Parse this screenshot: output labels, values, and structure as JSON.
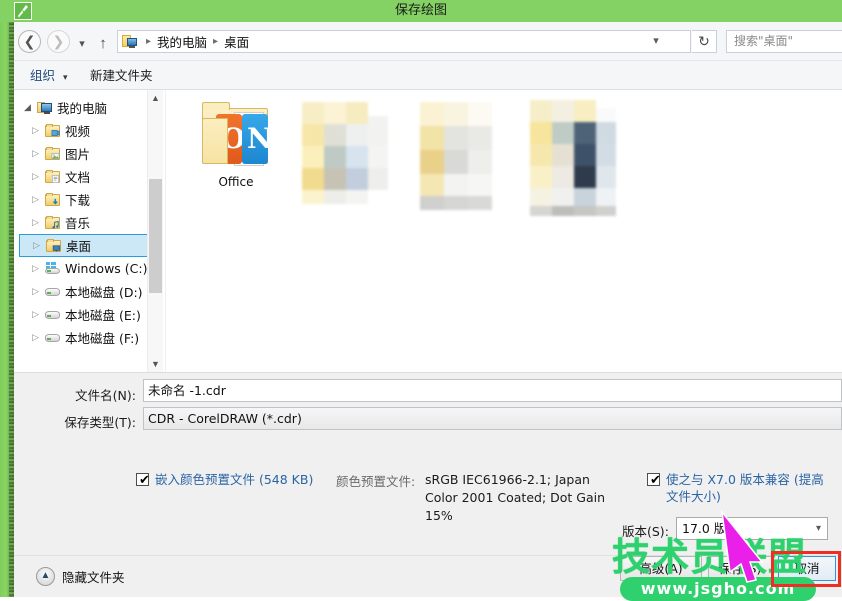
{
  "window": {
    "title": "保存绘图",
    "app_icon": "pen-nib-icon",
    "titlebar_color": "#83d263",
    "chrome_color": "#82d25d"
  },
  "navbar": {
    "back_icon": "back-arrow-icon",
    "forward_icon": "forward-arrow-icon",
    "recent_icon": "recent-locations-chevron-icon",
    "up_icon": "up-arrow-icon",
    "breadcrumb_icon": "computer-icon",
    "breadcrumb": [
      {
        "label": "我的电脑"
      },
      {
        "label": "桌面"
      }
    ],
    "separator": "▸",
    "dropdown_icon": "chevron-down-icon",
    "refresh_icon": "refresh-icon",
    "search_placeholder": "搜索\"桌面\""
  },
  "commandbar": {
    "organize_label": "组织",
    "organize_caret": "▾",
    "new_folder_label": "新建文件夹"
  },
  "tree": {
    "items": [
      {
        "label": "我的电脑",
        "level": 0,
        "twisty": "◢",
        "icon": "computer-icon",
        "selected": false
      },
      {
        "label": "视频",
        "level": 1,
        "twisty": "▷",
        "icon": "folder-video-icon",
        "selected": false
      },
      {
        "label": "图片",
        "level": 1,
        "twisty": "▷",
        "icon": "folder-pictures-icon",
        "selected": false
      },
      {
        "label": "文档",
        "level": 1,
        "twisty": "▷",
        "icon": "folder-documents-icon",
        "selected": false
      },
      {
        "label": "下载",
        "level": 1,
        "twisty": "▷",
        "icon": "folder-downloads-icon",
        "selected": false
      },
      {
        "label": "音乐",
        "level": 1,
        "twisty": "▷",
        "icon": "folder-music-icon",
        "selected": false
      },
      {
        "label": "桌面",
        "level": 1,
        "twisty": "▷",
        "icon": "folder-desktop-icon",
        "selected": true
      },
      {
        "label": "Windows (C:)",
        "level": 1,
        "twisty": "▷",
        "icon": "windows-drive-icon",
        "selected": false
      },
      {
        "label": "本地磁盘 (D:)",
        "level": 1,
        "twisty": "▷",
        "icon": "drive-icon",
        "selected": false
      },
      {
        "label": "本地磁盘 (E:)",
        "level": 1,
        "twisty": "▷",
        "icon": "drive-icon",
        "selected": false
      },
      {
        "label": "本地磁盘 (F:)",
        "level": 1,
        "twisty": "▷",
        "icon": "drive-icon",
        "selected": false
      }
    ],
    "scroll_up_icon": "scroll-up-icon",
    "scroll_down_icon": "scroll-down-icon"
  },
  "content": {
    "files": [
      {
        "label": "Office",
        "icon": "office-folder-icon",
        "blurred": false
      },
      {
        "label": "",
        "icon": "folder-icon",
        "blurred": true
      },
      {
        "label": "",
        "icon": "folder-icon",
        "blurred": true
      },
      {
        "label": "",
        "icon": "folder-icon",
        "blurred": true
      }
    ]
  },
  "form": {
    "filename_label": "文件名(N):",
    "filename_value": "未命名 -1.cdr",
    "filetype_label": "保存类型(T):",
    "filetype_value": "CDR - CorelDRAW (*.cdr)"
  },
  "options": {
    "embed_profile": {
      "checked": true,
      "check_glyph": "✔",
      "label": "嵌入颜色预置文件 (548 KB)"
    },
    "color_profile": {
      "label": "颜色预置文件:",
      "value": "sRGB IEC61966-2.1; Japan Color 2001 Coated; Dot Gain 15%"
    },
    "compat": {
      "checked": true,
      "check_glyph": "✔",
      "label": "使之与 X7.0 版本兼容 (提高文件大小)"
    },
    "version": {
      "label": "版本(S):",
      "value": "17.0 版",
      "caret": "▾"
    }
  },
  "footer": {
    "hide_folders_label": "隐藏文件夹",
    "hide_folders_icon": "chevron-up-circle-icon",
    "advanced_label": "高级(A)",
    "save_label": "保存(S)",
    "cancel_label": "取消"
  },
  "annotation": {
    "highlight_color": "#ee2d24",
    "cursor_icon": "mouse-pointer-arrow-icon",
    "cursor_color": "#e81ee8"
  },
  "watermark": {
    "brand": "技术员联盟",
    "url": "www.jsgho.com",
    "color": "#2fd06e"
  }
}
